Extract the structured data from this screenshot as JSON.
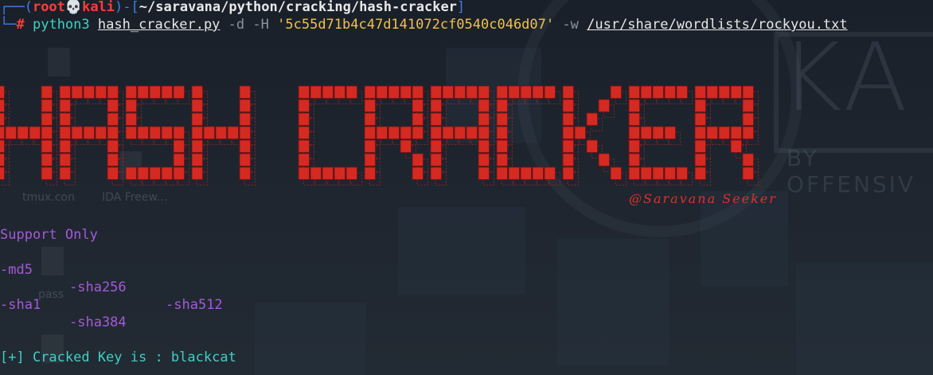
{
  "prompt": {
    "user": "root",
    "skull": "💀",
    "host": "kali",
    "cwd": "~/saravana/python/cracking/hash-cracker",
    "symbol": "#"
  },
  "command": {
    "program": "python3",
    "script": "hash_cracker.py",
    "flag_d": "-d",
    "flag_H": "-H",
    "hash_value": "'5c55d71b4c47d141072cf0540c046d07'",
    "flag_w": "-w",
    "wordlist": "/usr/share/wordlists/rockyou.txt"
  },
  "banner": {
    "title": "HASH CRACKER",
    "signature": "@Saravana Seeker",
    "color": "#d42a22"
  },
  "support": {
    "heading": "Support Only",
    "options": [
      "-md5",
      "-sha256",
      "-sha512",
      "-sha1",
      "-sha384"
    ]
  },
  "result": {
    "text": "[+] Cracked Key is : blackcat"
  },
  "desktop": {
    "labels": [
      "tmux.con",
      "IDA Freew...",
      "pass"
    ],
    "brand": "KA",
    "brand_sub": "BY OFFENSIV"
  },
  "colors": {
    "background": "#1d232c",
    "prompt_bracket": "#3f7fe0",
    "prompt_user": "#ff3b3b",
    "command": "#3fd0c4",
    "string": "#f0c14b",
    "support_text": "#a35ad6",
    "result_text": "#3fd0c4"
  }
}
